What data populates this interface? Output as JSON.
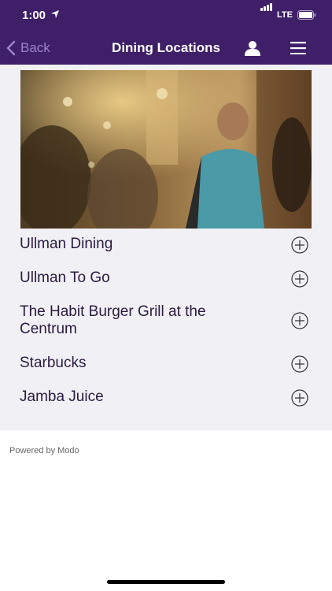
{
  "status_bar": {
    "time": "1:00",
    "network": "LTE"
  },
  "navbar": {
    "back_label": "Back",
    "title": "Dining Locations"
  },
  "locations": [
    {
      "label": "Ullman Dining"
    },
    {
      "label": "Ullman To Go"
    },
    {
      "label": "The Habit Burger Grill at the Centrum"
    },
    {
      "label": "Starbucks"
    },
    {
      "label": "Jamba Juice"
    }
  ],
  "footer": {
    "text": "Powered by Modo"
  },
  "colors": {
    "header": "#3f1f68",
    "back_link": "#9b84c8",
    "text": "#2a1b3f",
    "content_bg": "#f1f0f5"
  }
}
